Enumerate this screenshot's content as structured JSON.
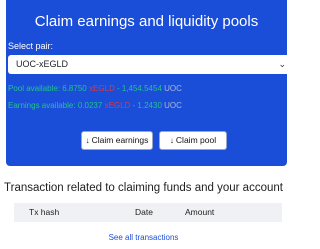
{
  "card": {
    "title": "Claim earnings and liquidity pools",
    "select_pair_label": "Select pair:",
    "pair_value": "UOC-xEGLD",
    "pool": {
      "prefix": "Pool available: 6.8750 ",
      "egld": "xEGLD",
      "middle": " - 1,454.5454 ",
      "uoc": "UOC"
    },
    "earnings": {
      "prefix": "Earnings available: 0.0237 ",
      "egld": "xEGLD",
      "middle": " - 1.2430 ",
      "uoc": "UOC"
    },
    "claim_earnings_label": "Claim earnings",
    "claim_pool_label": "Claim pool"
  },
  "transactions": {
    "title": "Transaction related to claiming funds and your account",
    "columns": [
      "Tx hash",
      "Date",
      "Amount"
    ],
    "see_all": "See all transactions"
  },
  "colors": {
    "accent": "#1b4ed8",
    "green": "#21c28c",
    "red": "#e0393e"
  }
}
